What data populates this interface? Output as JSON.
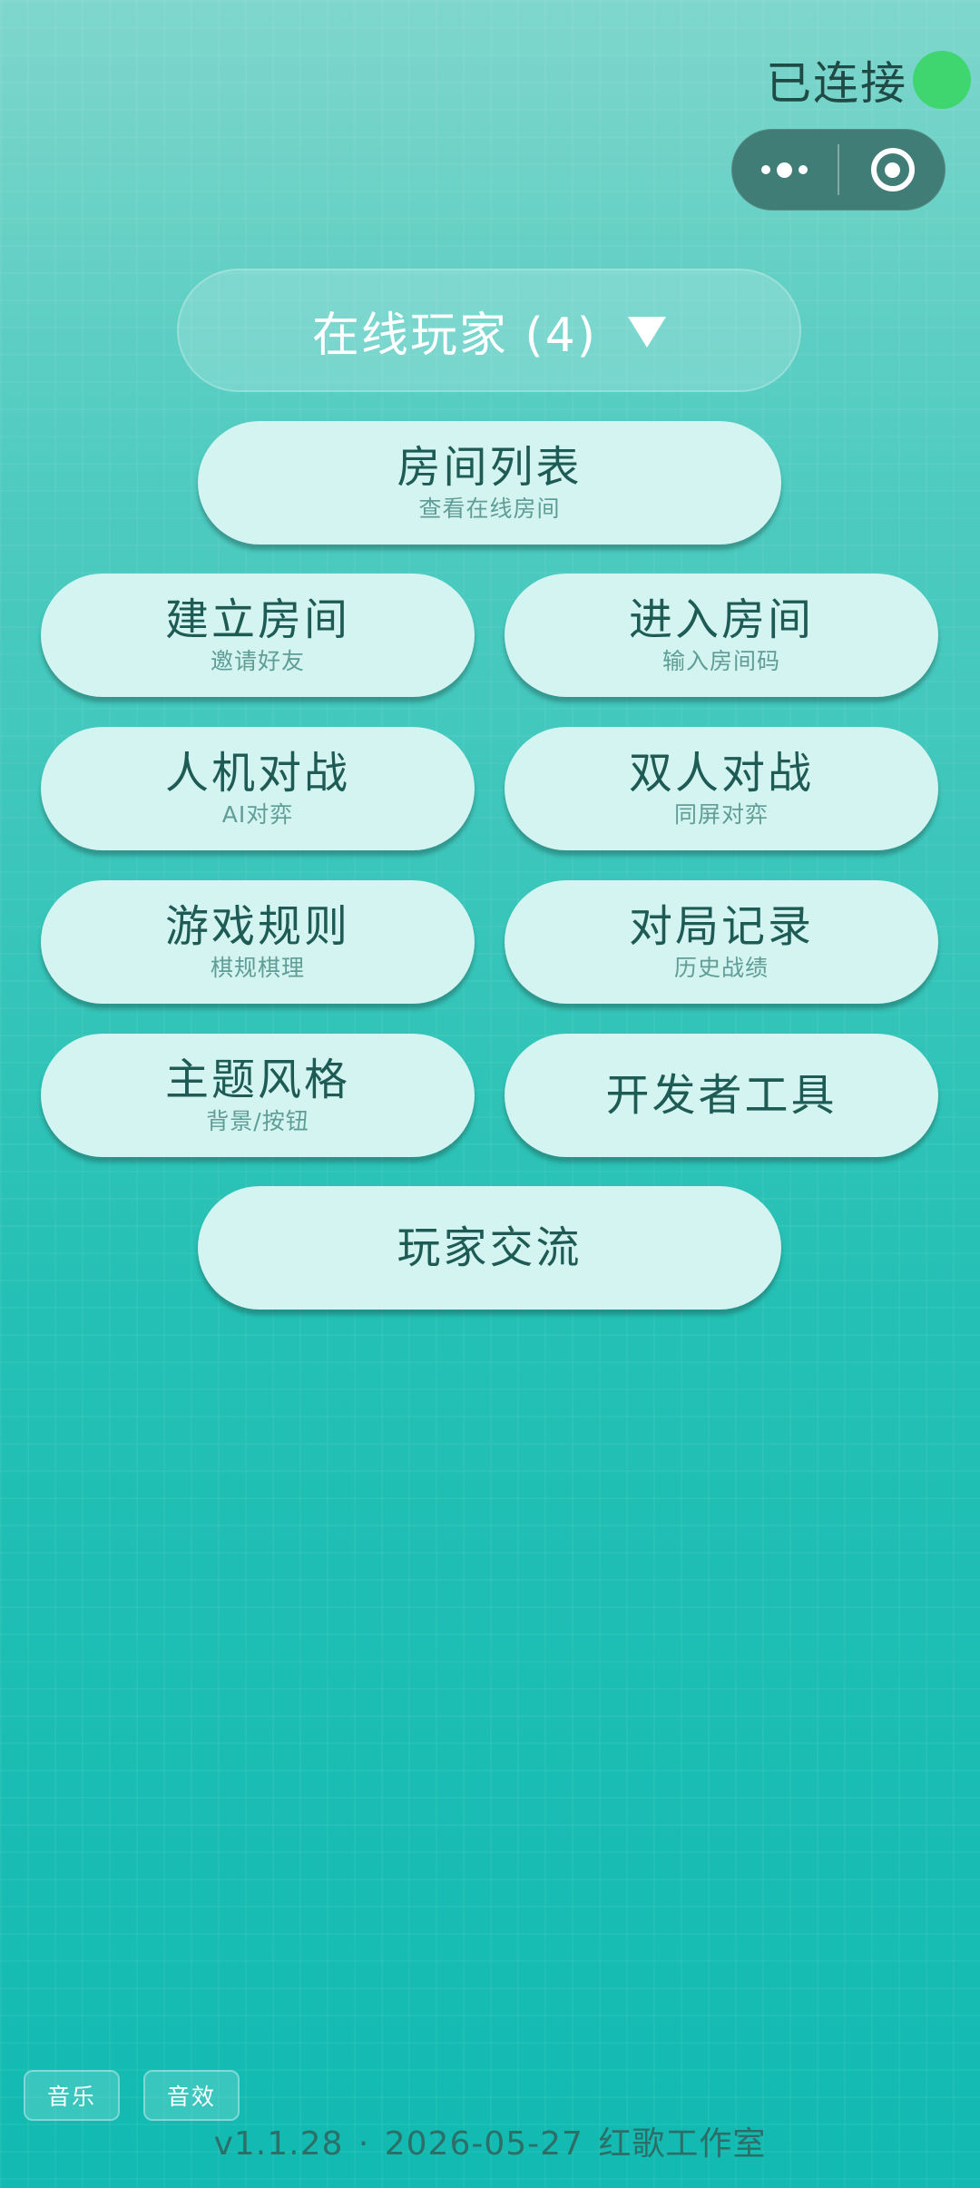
{
  "status": {
    "text": "已连接",
    "indicator_color": "#3fd56f"
  },
  "capsule": {
    "more_icon": "more-dots-icon",
    "close_icon": "target-circle-icon"
  },
  "online": {
    "label": "在线玩家 (4)",
    "arrow_icon": "triangle-down-icon"
  },
  "menu": {
    "room_list": {
      "title": "房间列表",
      "subtitle": "查看在线房间"
    },
    "create_room": {
      "title": "建立房间",
      "subtitle": "邀请好友"
    },
    "join_room": {
      "title": "进入房间",
      "subtitle": "输入房间码"
    },
    "vs_ai": {
      "title": "人机对战",
      "subtitle": "AI对弈"
    },
    "two_player": {
      "title": "双人对战",
      "subtitle": "同屏对弈"
    },
    "rules": {
      "title": "游戏规则",
      "subtitle": "棋规棋理"
    },
    "history": {
      "title": "对局记录",
      "subtitle": "历史战绩"
    },
    "theme": {
      "title": "主题风格",
      "subtitle": "背景/按钮"
    },
    "dev_tools": {
      "title": "开发者工具"
    },
    "community": {
      "title": "玩家交流"
    }
  },
  "audio": {
    "music_label": "音乐",
    "sfx_label": "音效"
  },
  "footer": {
    "text": "v1.1.28 · 2026-05-27  红歌工作室"
  },
  "colors": {
    "button_bg": "#d3f4f0",
    "button_text": "#1e5b55",
    "button_subtext": "#5f9d96",
    "background_top": "#7fd6cc",
    "background_bottom": "#12bab1"
  }
}
